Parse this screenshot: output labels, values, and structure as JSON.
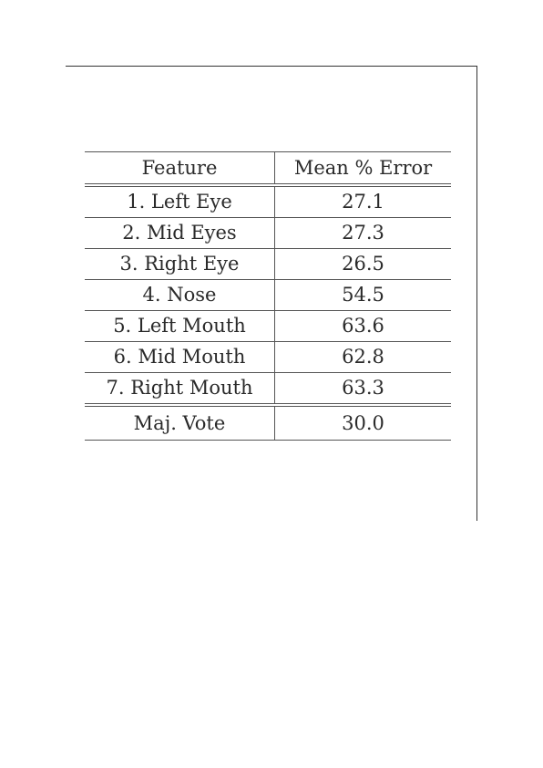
{
  "table": {
    "headers": [
      "Feature",
      "Mean % Error"
    ],
    "rows": [
      [
        "1. Left Eye",
        "27.1"
      ],
      [
        "2. Mid Eyes",
        "27.3"
      ],
      [
        "3. Right Eye",
        "26.5"
      ],
      [
        "4. Nose",
        "54.5"
      ],
      [
        "5. Left Mouth",
        "63.6"
      ],
      [
        "6. Mid Mouth",
        "62.8"
      ],
      [
        "7. Right Mouth",
        "63.3"
      ]
    ],
    "summary": [
      "Maj. Vote",
      "30.0"
    ]
  }
}
